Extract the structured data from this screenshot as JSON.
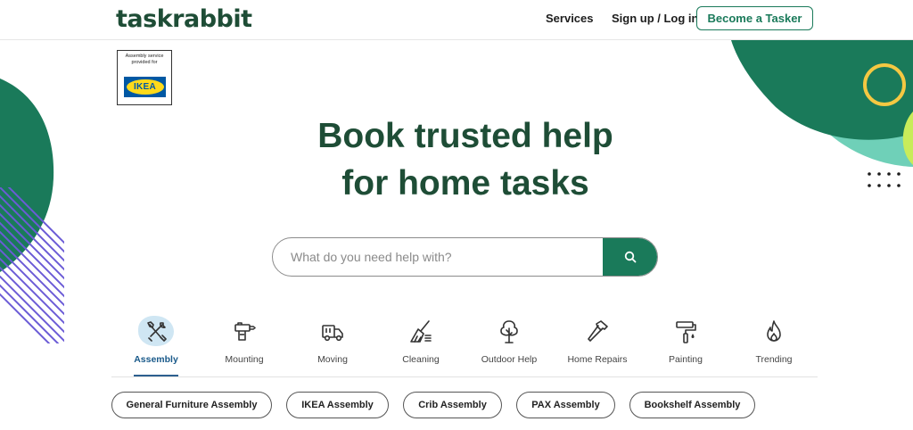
{
  "header": {
    "logo": "taskrabbit",
    "nav_services": "Services",
    "nav_signup": "Sign up / Log in",
    "cta": "Become a Tasker"
  },
  "badge": {
    "text": "Assembly service provided for",
    "brand": "IKEA"
  },
  "hero": {
    "line1": "Book trusted help",
    "line2": "for home tasks"
  },
  "search": {
    "placeholder": "What do you need help with?",
    "value": ""
  },
  "categories": [
    {
      "label": "Assembly",
      "icon": "tools-icon",
      "active": true
    },
    {
      "label": "Mounting",
      "icon": "drill-icon",
      "active": false
    },
    {
      "label": "Moving",
      "icon": "truck-icon",
      "active": false
    },
    {
      "label": "Cleaning",
      "icon": "broom-icon",
      "active": false
    },
    {
      "label": "Outdoor Help",
      "icon": "tree-icon",
      "active": false
    },
    {
      "label": "Home Repairs",
      "icon": "hammer-icon",
      "active": false
    },
    {
      "label": "Painting",
      "icon": "paint-roller-icon",
      "active": false
    },
    {
      "label": "Trending",
      "icon": "flame-icon",
      "active": false
    }
  ],
  "chips": [
    "General Furniture Assembly",
    "IKEA Assembly",
    "Crib Assembly",
    "PAX Assembly",
    "Bookshelf Assembly"
  ],
  "colors": {
    "brand_green": "#1e4d36",
    "accent_green": "#1a7a5a",
    "active_blue": "#1a5a8a",
    "mint": "#6fd0b8",
    "yellow": "#f5c842",
    "purple": "#6b5bd6"
  }
}
